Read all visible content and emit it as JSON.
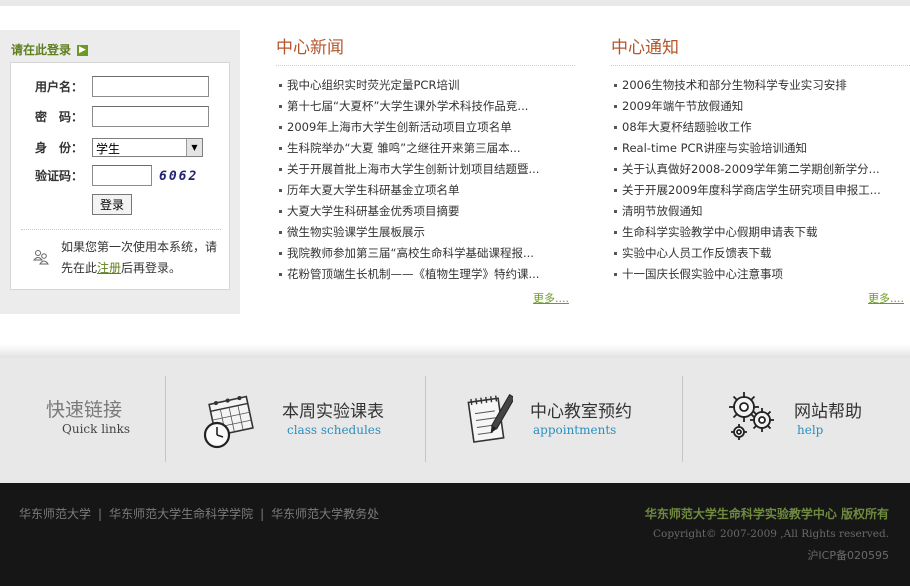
{
  "login": {
    "title": "请在此登录",
    "arrow_icon": "arrow-right-icon",
    "username_label": "用户名：",
    "password_label": "密　码：",
    "identity_label": "身　份：",
    "identity_value": "学生",
    "captcha_label": "验证码：",
    "captcha_code": "6062",
    "submit_label": "登录",
    "register_text_before": "如果您第一次使用本系统，请先在此",
    "register_link": "注册",
    "register_text_after": "后再登录。"
  },
  "news": {
    "title": "中心新闻",
    "items": [
      "我中心组织实时荧光定量PCR培训",
      "第十七届“大夏杯”大学生课外学术科技作品竞...",
      "2009年上海市大学生创新活动项目立项名单",
      "生科院举办“大夏 雏鸣”之继往开来第三届本...",
      "关于开展首批上海市大学生创新计划项目结题暨...",
      "历年大夏大学生科研基金立项名单",
      "大夏大学生科研基金优秀项目摘要",
      "微生物实验课学生展板展示",
      "我院教师参加第三届“高校生命科学基础课程报...",
      "花粉管顶端生长机制——《植物生理学》特约课..."
    ],
    "more": "更多...."
  },
  "notices": {
    "title": "中心通知",
    "items": [
      "2006生物技术和部分生物科学专业实习安排",
      "2009年端午节放假通知",
      "08年大夏杯结题验收工作",
      "Real-time PCR讲座与实验培训通知",
      "关于认真做好2008-2009学年第二学期创新学分...",
      "关于开展2009年度科学商店学生研究项目申报工...",
      "清明节放假通知",
      "生命科学实验教学中心假期申请表下载",
      "实验中心人员工作反馈表下载",
      "十一国庆长假实验中心注意事项"
    ],
    "more": "更多...."
  },
  "quick_links": {
    "title_cn": "快速链接",
    "title_en": "Quick links",
    "links": [
      {
        "cn": "本周实验课表",
        "en": "class schedules",
        "icon": "calendar-clock-icon"
      },
      {
        "cn": "中心教室预约",
        "en": "appointments",
        "icon": "notepad-pen-icon"
      },
      {
        "cn": "网站帮助",
        "en": "help",
        "icon": "gears-icon"
      }
    ]
  },
  "footer": {
    "links": [
      "华东师范大学",
      "华东师范大学生命科学学院",
      "华东师范大学教务处"
    ],
    "separator": "|",
    "owner": "华东师范大学生命科学实验教学中心 版权所有",
    "copyright": "Copyright© 2007-2009 ,All Rights reserved.",
    "icp": "沪ICP备020595"
  },
  "colors": {
    "accent_green": "#6c9a24",
    "title_orange": "#b4562b",
    "link_blue": "#2a8fbf",
    "footer_bg": "#161616"
  }
}
